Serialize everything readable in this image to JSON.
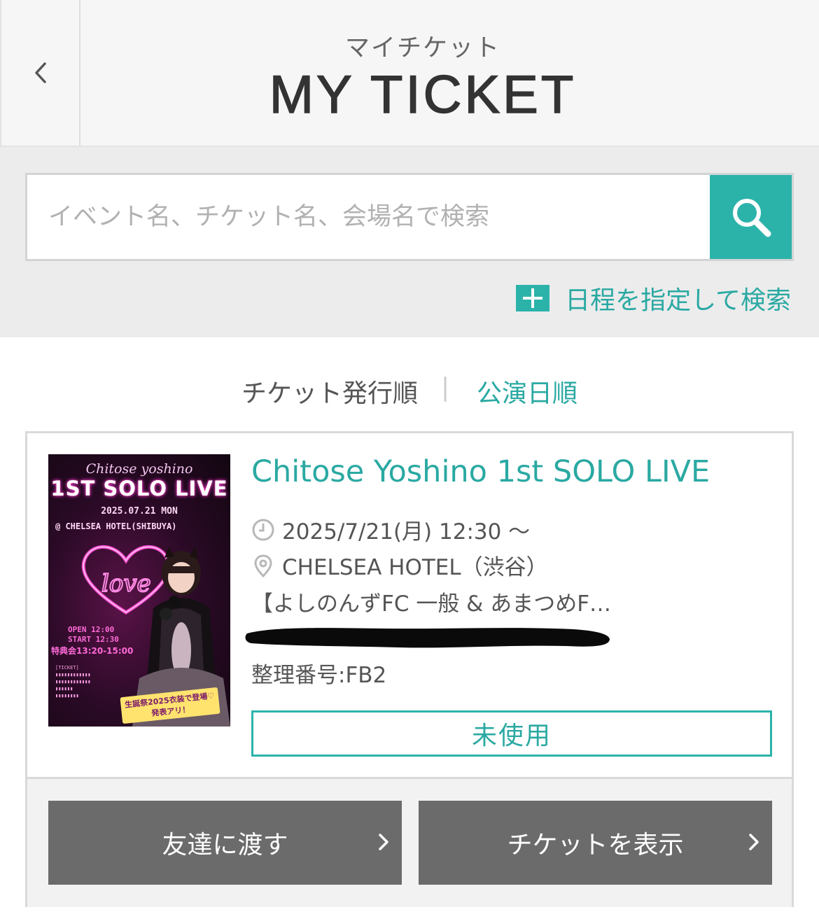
{
  "header": {
    "title_ja": "マイチケット",
    "title_en": "MY TICKET",
    "back_icon": "chevron-left-icon"
  },
  "search": {
    "placeholder": "イベント名、チケット名、会場名で検索",
    "value": "",
    "button_icon": "search-icon",
    "date_search_label": "日程を指定して検索",
    "date_search_icon": "plus-icon"
  },
  "sort": {
    "issue_order": "チケット発行順",
    "separator": "|",
    "performance_order": "公演日順",
    "active": "performance_order"
  },
  "ticket": {
    "poster": {
      "subtitle": "Chitose yoshino",
      "title": "1ST SOLO LIVE",
      "date": "2025.07.21 MON",
      "venue": "@ CHELSEA HOTEL(SHIBUYA)",
      "open": "OPEN 12:00",
      "start": "START 12:30",
      "tokuten": "特典会13:20-15:00",
      "banner": "生誕祭2025衣装で登場♡ 発表アリ！"
    },
    "event_title": "Chitose Yoshino 1st SOLO LIVE",
    "datetime": "2025/7/21(月) 12:30 ～",
    "venue": "CHELSEA HOTEL（渋谷）",
    "ticket_name": "【よしのんずFC 一般 & あまつめF…",
    "seat": "整理番号:FB2",
    "status": "未使用",
    "clock_icon": "clock-icon",
    "pin_icon": "location-pin-icon"
  },
  "actions": {
    "give_label": "友達に渡す",
    "show_label": "チケットを表示"
  },
  "colors": {
    "accent": "#2bb3aa",
    "button_gray": "#6b6b6b",
    "header_bg": "#f6f6f6",
    "search_bg": "#ececed"
  }
}
